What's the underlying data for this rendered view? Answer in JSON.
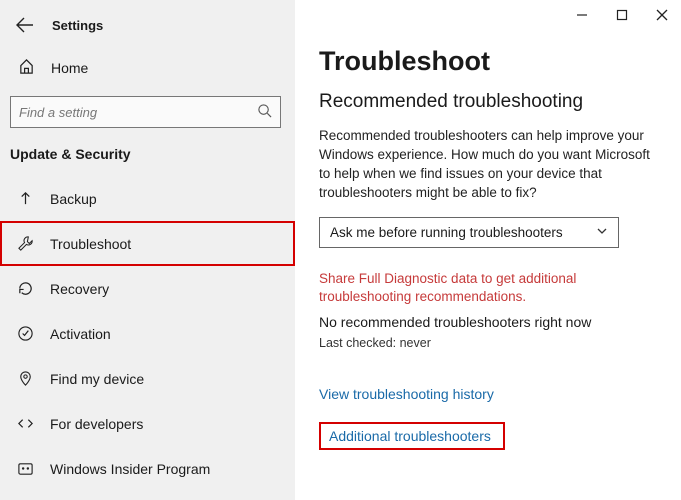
{
  "app": {
    "title": "Settings"
  },
  "sidebar": {
    "home": "Home",
    "search_placeholder": "Find a setting",
    "section": "Update & Security",
    "items": [
      {
        "label": "Backup"
      },
      {
        "label": "Troubleshoot"
      },
      {
        "label": "Recovery"
      },
      {
        "label": "Activation"
      },
      {
        "label": "Find my device"
      },
      {
        "label": "For developers"
      },
      {
        "label": "Windows Insider Program"
      }
    ]
  },
  "main": {
    "title": "Troubleshoot",
    "subtitle": "Recommended troubleshooting",
    "description": "Recommended troubleshooters can help improve your Windows experience. How much do you want Microsoft to help when we find issues on your device that troubleshooters might be able to fix?",
    "dropdown_value": "Ask me before running troubleshooters",
    "diag_warning": "Share Full Diagnostic data to get additional troubleshooting recommendations.",
    "no_recommended": "No recommended troubleshooters right now",
    "last_checked": "Last checked: never",
    "history_link": "View troubleshooting history",
    "additional_link": "Additional troubleshooters"
  }
}
